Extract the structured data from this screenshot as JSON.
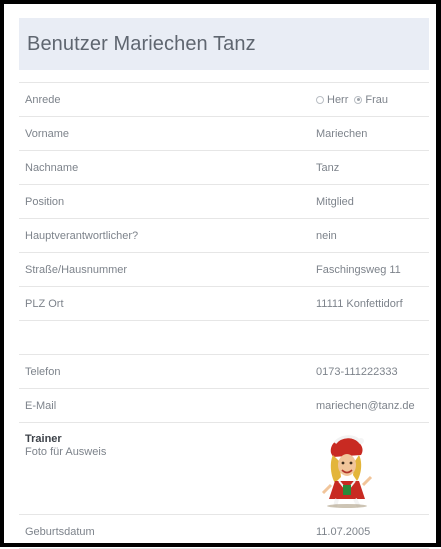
{
  "header": {
    "title": "Benutzer Mariechen Tanz"
  },
  "rows": [
    {
      "label": "Anrede",
      "options": [
        "Herr",
        "Frau"
      ],
      "selected": "Frau"
    },
    {
      "label": "Vorname",
      "value": "Mariechen"
    },
    {
      "label": "Nachname",
      "value": "Tanz"
    },
    {
      "label": "Position",
      "value": "Mitglied"
    },
    {
      "label": "Hauptverantwortlicher?",
      "value": "nein"
    },
    {
      "label": "Straße/Hausnummer",
      "value": "Faschingsweg 11"
    },
    {
      "label": "PLZ Ort",
      "value": "11111 Konfettidorf"
    },
    {
      "label": "Telefon",
      "value": "0173-111222333"
    },
    {
      "label": "E-Mail",
      "value": "mariechen@tanz.de"
    },
    {
      "label_title": "Trainer",
      "label_sub": "Foto für Ausweis"
    },
    {
      "label": "Geburtsdatum",
      "value": "11.07.2005"
    }
  ],
  "colors": {
    "header_bg": "#e9edf5",
    "text": "#7d838b",
    "title": "#5f6670"
  }
}
